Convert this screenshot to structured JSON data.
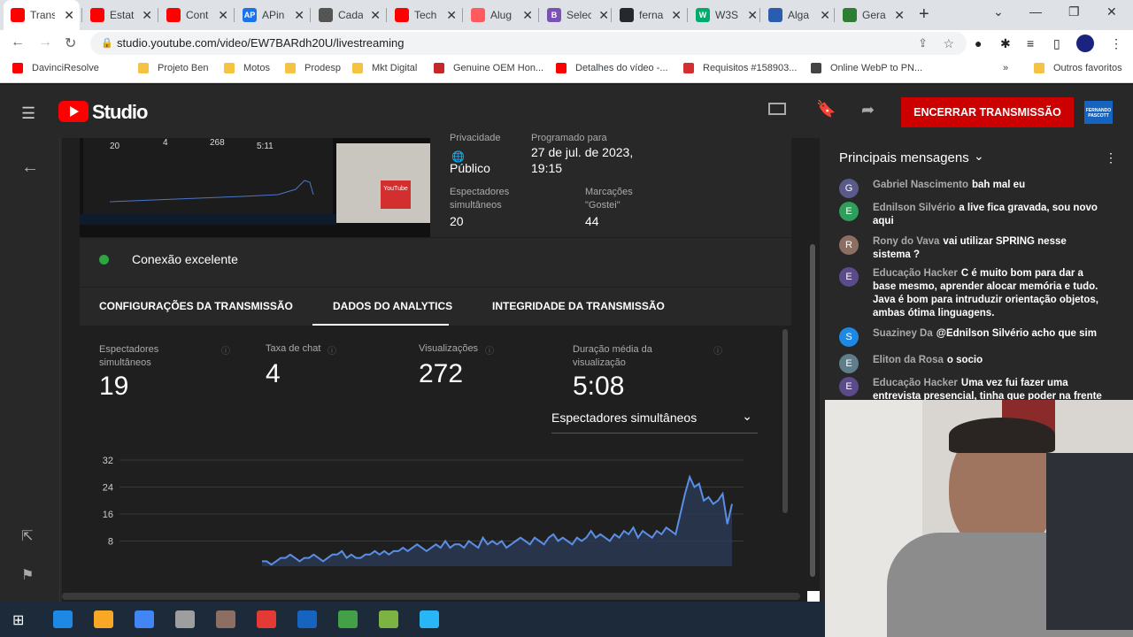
{
  "browser": {
    "tabs": [
      {
        "title": "Trans",
        "color": "#ff0000",
        "active": true
      },
      {
        "title": "Estat",
        "color": "#ff0000"
      },
      {
        "title": "Cont",
        "color": "#ff0000"
      },
      {
        "title": "APin",
        "color": "#1a73e8",
        "glyph": "AP"
      },
      {
        "title": "Cada",
        "color": "#555555"
      },
      {
        "title": "Tech",
        "color": "#ff0000"
      },
      {
        "title": "Alug",
        "color": "#ff5a5f"
      },
      {
        "title": "Selec",
        "color": "#7952b3",
        "glyph": "B"
      },
      {
        "title": "ferna",
        "color": "#24292f"
      },
      {
        "title": "W3S",
        "color": "#04aa6d",
        "glyph": "W"
      },
      {
        "title": "Alga",
        "color": "#2a5db0"
      },
      {
        "title": "Gera",
        "color": "#2e7d32"
      }
    ],
    "url": "studio.youtube.com/video/EW7BARdh20U/livestreaming",
    "bookmarks": [
      {
        "label": "DavinciResolve",
        "color": "#ff0000"
      },
      {
        "label": "Projeto Ben",
        "color": "#f5c342"
      },
      {
        "label": "Motos",
        "color": "#f5c342"
      },
      {
        "label": "Prodesp",
        "color": "#f5c342"
      },
      {
        "label": "Mkt Digital",
        "color": "#f5c342"
      },
      {
        "label": "Genuine OEM Hon...",
        "color": "#c62828"
      },
      {
        "label": "Detalhes do vídeo -...",
        "color": "#ff0000"
      },
      {
        "label": "Requisitos #158903...",
        "color": "#d32f2f"
      },
      {
        "label": "Online WebP to PN...",
        "color": "#444444"
      }
    ],
    "more_bookmarks": "»",
    "other_favorites": "Outros favoritos"
  },
  "studio": {
    "logo": "Studio",
    "end_button": "ENCERRAR TRANSMISSÃO",
    "avatar_text": "FERNANDO PASCOTT",
    "preview": {
      "n1": "20",
      "n2": "4",
      "n3": "268",
      "n4": "5:11"
    },
    "visibility_label": "Privacidade",
    "visibility_value": "Público",
    "scheduled_label": "Programado para",
    "scheduled_value_1": "27 de jul. de 2023,",
    "scheduled_value_2": "19:15",
    "concurrent_label": "Espectadores simultâneos",
    "concurrent_value": "20",
    "likes_label": "Marcações \"Gostei\"",
    "likes_value": "44",
    "connection": "Conexão excelente",
    "tabs": [
      "CONFIGURAÇÕES DA TRANSMISSÃO",
      "DADOS DO ANALYTICS",
      "INTEGRIDADE DA TRANSMISSÃO"
    ],
    "metrics": [
      {
        "label": "Espectadores simultâneos",
        "value": "19"
      },
      {
        "label": "Taxa de chat",
        "value": "4"
      },
      {
        "label": "Visualizações",
        "value": "272"
      },
      {
        "label": "Duração média da visualização",
        "value": "5:08"
      }
    ],
    "dropdown": "Espectadores simultâneos"
  },
  "chat": {
    "title": "Principais mensagens",
    "messages": [
      {
        "author": "Gabriel Nascimento",
        "text": "bah mal eu",
        "initial": "G",
        "color": "#5a5a8a"
      },
      {
        "author": "Ednilson Silvério",
        "text": "a live fica gravada, sou novo aqui",
        "initial": "E",
        "color": "#2e9e5b"
      },
      {
        "author": "Rony do Vava",
        "text": "vai utilizar SPRING nesse sistema ?",
        "initial": "R",
        "color": "#8d6e63"
      },
      {
        "author": "Educação Hacker",
        "text": "C é muito bom para dar a base mesmo, aprender alocar memória e tudo. Java é bom para intruduzir orientação objetos, ambas ótima linguagens.",
        "initial": "E",
        "color": "#5c4b8a"
      },
      {
        "author": "Suaziney Da",
        "text": "@Ednilson Silvério acho que sim",
        "initial": "S",
        "color": "#1e88e5"
      },
      {
        "author": "Eliton da Rosa",
        "text": "o socio",
        "initial": "E",
        "color": "#607d8b"
      },
      {
        "author": "Educação Hacker",
        "text": "Uma vez fui fazer uma entrevista presencial, tinha que poder na frente",
        "initial": "E",
        "color": "#5c4b8a"
      }
    ]
  },
  "chart_data": {
    "type": "area",
    "yticks": [
      "32",
      "24",
      "16",
      "8"
    ],
    "ylim": [
      0,
      32
    ],
    "x": [
      0,
      1,
      2,
      3,
      4,
      5,
      6,
      7,
      8,
      9,
      10,
      11,
      12,
      13,
      14,
      15,
      16,
      17,
      18,
      19,
      20,
      21,
      22,
      23,
      24,
      25,
      26,
      27,
      28,
      29,
      30,
      31,
      32,
      33,
      34,
      35,
      36,
      37,
      38,
      39,
      40,
      41,
      42,
      43,
      44,
      45,
      46,
      47,
      48,
      49,
      50,
      51,
      52,
      53,
      54,
      55,
      56,
      57,
      58,
      59,
      60,
      61,
      62,
      63,
      64,
      65,
      66,
      67,
      68,
      69,
      70,
      71,
      72,
      73,
      74,
      75,
      76,
      77,
      78,
      79,
      80,
      81,
      82,
      83,
      84,
      85,
      86,
      87,
      88,
      89,
      90,
      91,
      92,
      93,
      94,
      95,
      96,
      97,
      98,
      99,
      100
    ],
    "values": [
      2,
      2,
      1,
      2,
      3,
      3,
      4,
      3,
      2,
      3,
      3,
      4,
      3,
      2,
      3,
      4,
      4,
      5,
      3,
      4,
      3,
      3,
      4,
      4,
      5,
      4,
      5,
      4,
      5,
      5,
      6,
      5,
      6,
      7,
      6,
      5,
      6,
      7,
      6,
      8,
      6,
      7,
      7,
      6,
      8,
      7,
      6,
      9,
      7,
      8,
      7,
      8,
      6,
      7,
      8,
      9,
      8,
      7,
      9,
      8,
      7,
      9,
      10,
      8,
      9,
      8,
      7,
      9,
      8,
      9,
      11,
      9,
      10,
      9,
      8,
      10,
      9,
      11,
      10,
      12,
      9,
      11,
      10,
      9,
      11,
      10,
      12,
      11,
      10,
      16,
      22,
      27,
      24,
      25,
      20,
      21,
      19,
      20,
      22,
      13,
      19
    ]
  },
  "taskbar": {
    "apps": [
      "#1e88e5",
      "#f9a825",
      "#4285f4",
      "#9e9e9e",
      "#8d6e63",
      "#e53935",
      "#1565c0",
      "#43a047",
      "#7cb342",
      "#29b6f6"
    ]
  }
}
